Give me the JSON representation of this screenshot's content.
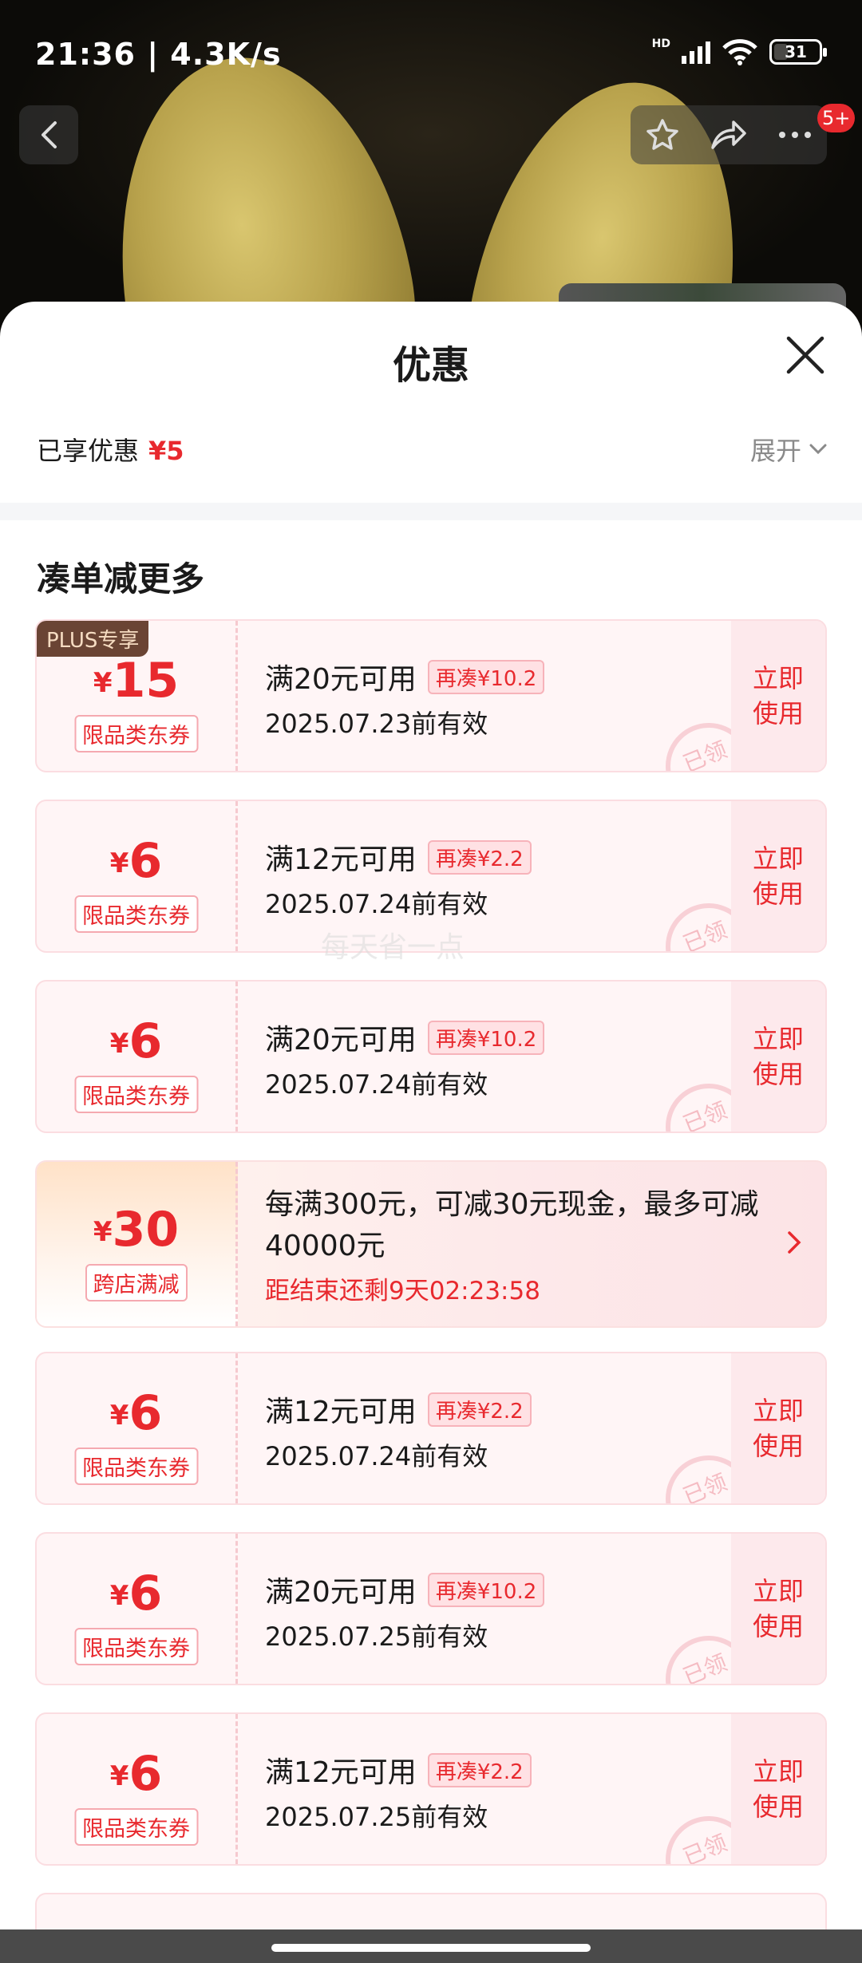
{
  "status": {
    "time": "21:36 | 4.3K/s",
    "network": "HD",
    "battery": "31"
  },
  "nav": {
    "badge": "5+"
  },
  "sheet": {
    "title": "优惠",
    "enjoyed_label": "已享优惠",
    "enjoyed_amount": "¥5",
    "expand_label": "展开",
    "section_title": "凑单减更多"
  },
  "watermark": "每天省一点",
  "coupons": [
    {
      "plus": "PLUS专享",
      "yen": "¥",
      "amount": "15",
      "tag": "限品类东券",
      "cond": "满20元可用",
      "more": "再凑¥10.2",
      "date": "2025.07.23前有效",
      "use": "立即\n使用",
      "stamp": "已领"
    },
    {
      "yen": "¥",
      "amount": "6",
      "tag": "限品类东券",
      "cond": "满12元可用",
      "more": "再凑¥2.2",
      "date": "2025.07.24前有效",
      "use": "立即\n使用",
      "stamp": "已领"
    },
    {
      "yen": "¥",
      "amount": "6",
      "tag": "限品类东券",
      "cond": "满20元可用",
      "more": "再凑¥10.2",
      "date": "2025.07.24前有效",
      "use": "立即\n使用",
      "stamp": "已领"
    },
    {
      "yen": "¥",
      "amount": "6",
      "tag": "限品类东券",
      "cond": "满12元可用",
      "more": "再凑¥2.2",
      "date": "2025.07.24前有效",
      "use": "立即\n使用",
      "stamp": "已领"
    },
    {
      "yen": "¥",
      "amount": "6",
      "tag": "限品类东券",
      "cond": "满20元可用",
      "more": "再凑¥10.2",
      "date": "2025.07.25前有效",
      "use": "立即\n使用",
      "stamp": "已领"
    },
    {
      "yen": "¥",
      "amount": "6",
      "tag": "限品类东券",
      "cond": "满12元可用",
      "more": "再凑¥2.2",
      "date": "2025.07.25前有效",
      "use": "立即\n使用",
      "stamp": "已领"
    }
  ],
  "promo": {
    "yen": "¥",
    "amount": "30",
    "tag": "跨店满减",
    "desc": "每满300元，可减30元现金，最多可减40000元",
    "countdown": "距结束还剩9天02:23:58"
  }
}
